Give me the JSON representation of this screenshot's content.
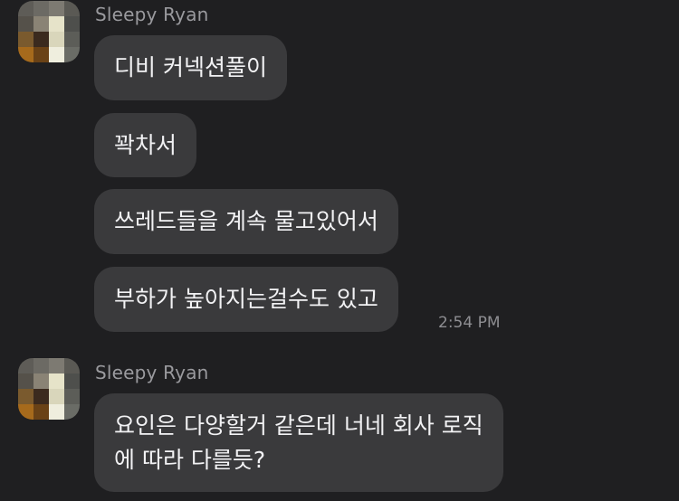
{
  "groups": [
    {
      "sender": "Sleepy Ryan",
      "messages": [
        "디비 커넥션풀이",
        "꽉차서",
        "쓰레드들을 계속 물고있어서",
        "부하가 높아지는걸수도 있고"
      ],
      "time": "2:54 PM"
    },
    {
      "sender": "Sleepy Ryan",
      "message_lines": [
        "요인은 다양할거 같은데 너네 회사 로직",
        "에 따라 다를듯?"
      ]
    }
  ],
  "avatar_pixels": [
    [
      "#5e5c57",
      "#6c6a64",
      "#7d7a72",
      "#5a5954"
    ],
    [
      "#55514a",
      "#8a8375",
      "#e6e3c9",
      "#4e4f4c"
    ],
    [
      "#7a5a2e",
      "#3b2a1e",
      "#d9d6bb",
      "#5c5d58"
    ],
    [
      "#a66a1c",
      "#6a4216",
      "#efeede",
      "#6a6c66"
    ]
  ]
}
